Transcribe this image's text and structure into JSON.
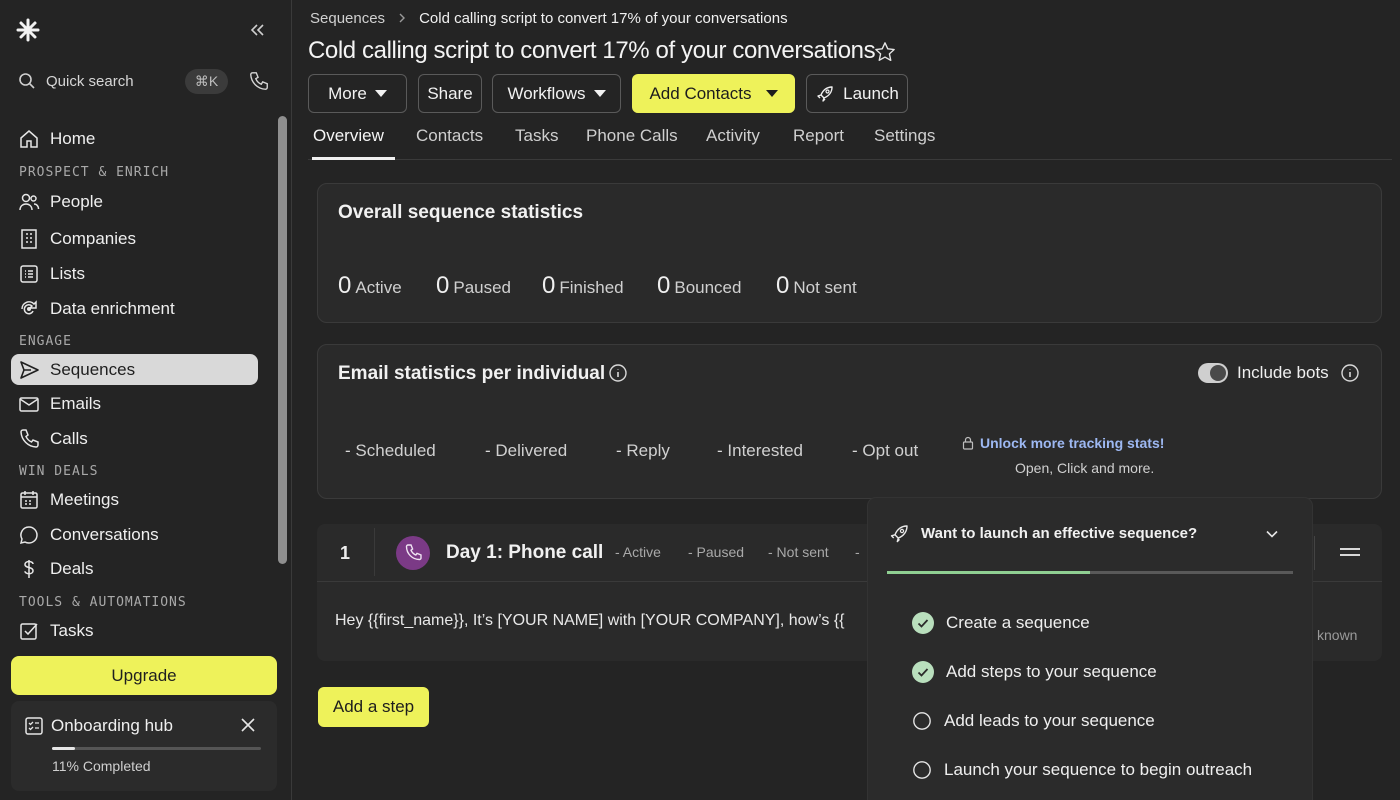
{
  "sidebar": {
    "search_label": "Quick search",
    "search_shortcut": "⌘K",
    "items": {
      "home": "Home",
      "people": "People",
      "companies": "Companies",
      "lists": "Lists",
      "data_enrichment": "Data enrichment",
      "sequences": "Sequences",
      "emails": "Emails",
      "calls": "Calls",
      "meetings": "Meetings",
      "conversations": "Conversations",
      "deals": "Deals",
      "tasks": "Tasks"
    },
    "sections": {
      "prospect": "PROSPECT & ENRICH",
      "engage": "ENGAGE",
      "win": "WIN DEALS",
      "tools": "TOOLS & AUTOMATIONS"
    },
    "upgrade_label": "Upgrade",
    "onboarding": {
      "title": "Onboarding hub",
      "progress_text": "11% Completed",
      "progress": 0.11
    }
  },
  "header": {
    "breadcrumb_root": "Sequences",
    "breadcrumb_current": "Cold calling script to convert 17% of your conversations",
    "title": "Cold calling script to convert 17% of your conversations",
    "buttons": {
      "more": "More",
      "share": "Share",
      "workflows": "Workflows",
      "add_contacts": "Add Contacts",
      "launch": "Launch"
    }
  },
  "tabs": [
    "Overview",
    "Contacts",
    "Tasks",
    "Phone Calls",
    "Activity",
    "Report",
    "Settings"
  ],
  "overall": {
    "title": "Overall sequence statistics",
    "stats": [
      {
        "value": "0",
        "label": "Active"
      },
      {
        "value": "0",
        "label": "Paused"
      },
      {
        "value": "0",
        "label": "Finished"
      },
      {
        "value": "0",
        "label": "Bounced"
      },
      {
        "value": "0",
        "label": "Not sent"
      }
    ]
  },
  "email_stats": {
    "title": "Email statistics per individual",
    "include_bots": "Include bots",
    "include_bots_enabled": true,
    "stats": [
      {
        "value": "-",
        "label": "Scheduled"
      },
      {
        "value": "-",
        "label": "Delivered"
      },
      {
        "value": "-",
        "label": "Reply"
      },
      {
        "value": "-",
        "label": "Interested"
      },
      {
        "value": "-",
        "label": "Opt out"
      }
    ],
    "unlock_link": "Unlock more tracking stats!",
    "unlock_sub": "Open, Click and more."
  },
  "step": {
    "number": "1",
    "title": "Day 1: Phone call",
    "stats": [
      "- Active",
      "- Paused",
      "- Not sent",
      "-"
    ],
    "body": "Hey {{first_name}}, It’s [YOUR NAME] with [YOUR COMPANY], how’s {{",
    "trailing": "known"
  },
  "add_step_label": "Add a step",
  "popup": {
    "title": "Want to launch an effective sequence?",
    "progress": 0.5,
    "items": [
      {
        "label": "Create a sequence",
        "done": true
      },
      {
        "label": "Add steps to your sequence",
        "done": true
      },
      {
        "label": "Add leads to your sequence",
        "done": false
      },
      {
        "label": "Launch your sequence to begin outreach",
        "done": false
      }
    ]
  },
  "colors": {
    "accent": "#eef25a",
    "progress": "#8fcf92",
    "call_icon": "#7b3a86",
    "link": "#9db8f2"
  }
}
